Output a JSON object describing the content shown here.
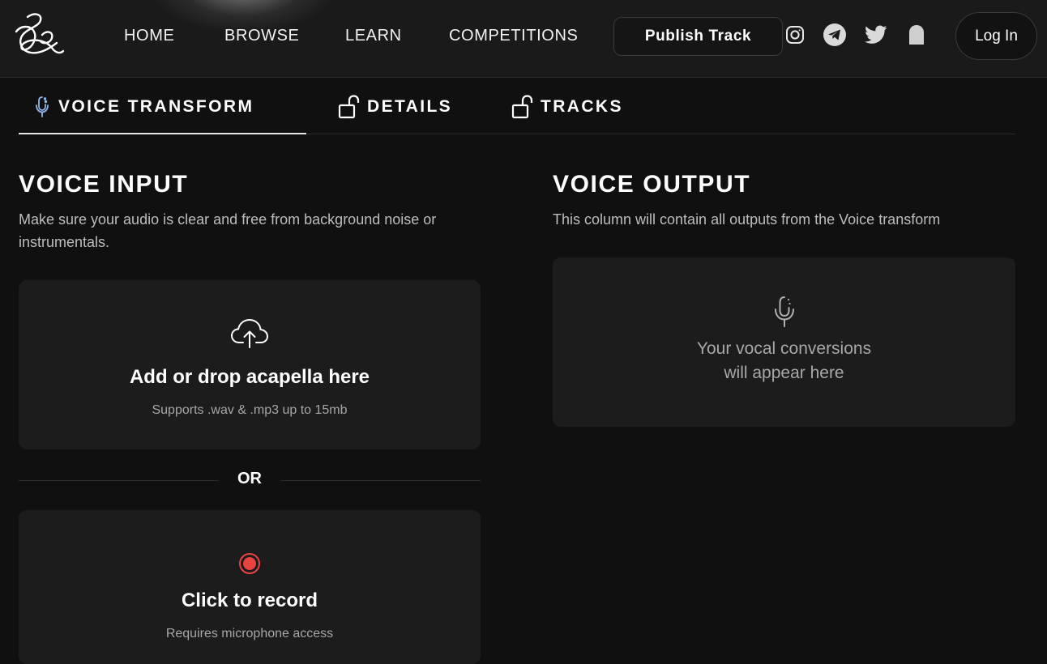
{
  "nav": {
    "links": [
      "HOME",
      "BROWSE",
      "LEARN",
      "COMPETITIONS"
    ],
    "publish_label": "Publish Track",
    "login_label": "Log In",
    "social_icons": [
      "instagram-icon",
      "telegram-icon",
      "twitter-icon",
      "ghost-icon"
    ]
  },
  "tabs": [
    {
      "label": "VOICE TRANSFORM",
      "icon": "microphone-icon",
      "active": true
    },
    {
      "label": "DETAILS",
      "icon": "unlock-icon",
      "active": false
    },
    {
      "label": "TRACKS",
      "icon": "unlock-icon",
      "active": false
    }
  ],
  "input": {
    "title": "VOICE INPUT",
    "description": "Make sure your audio is clear and free from background noise or instrumentals.",
    "upload_title": "Add or drop acapella here",
    "upload_sub": "Supports .wav & .mp3 up to 15mb",
    "or_label": "OR",
    "record_title": "Click to record",
    "record_sub": "Requires microphone access"
  },
  "output": {
    "title": "VOICE OUTPUT",
    "description": "This column will contain all outputs from the Voice transform",
    "placeholder_line1": "Your vocal conversions",
    "placeholder_line2": "will appear here"
  },
  "colors": {
    "background": "#101010",
    "card": "#1c1c1c",
    "record_red": "#e8433f",
    "mic_accent": "#8fb8e8"
  }
}
